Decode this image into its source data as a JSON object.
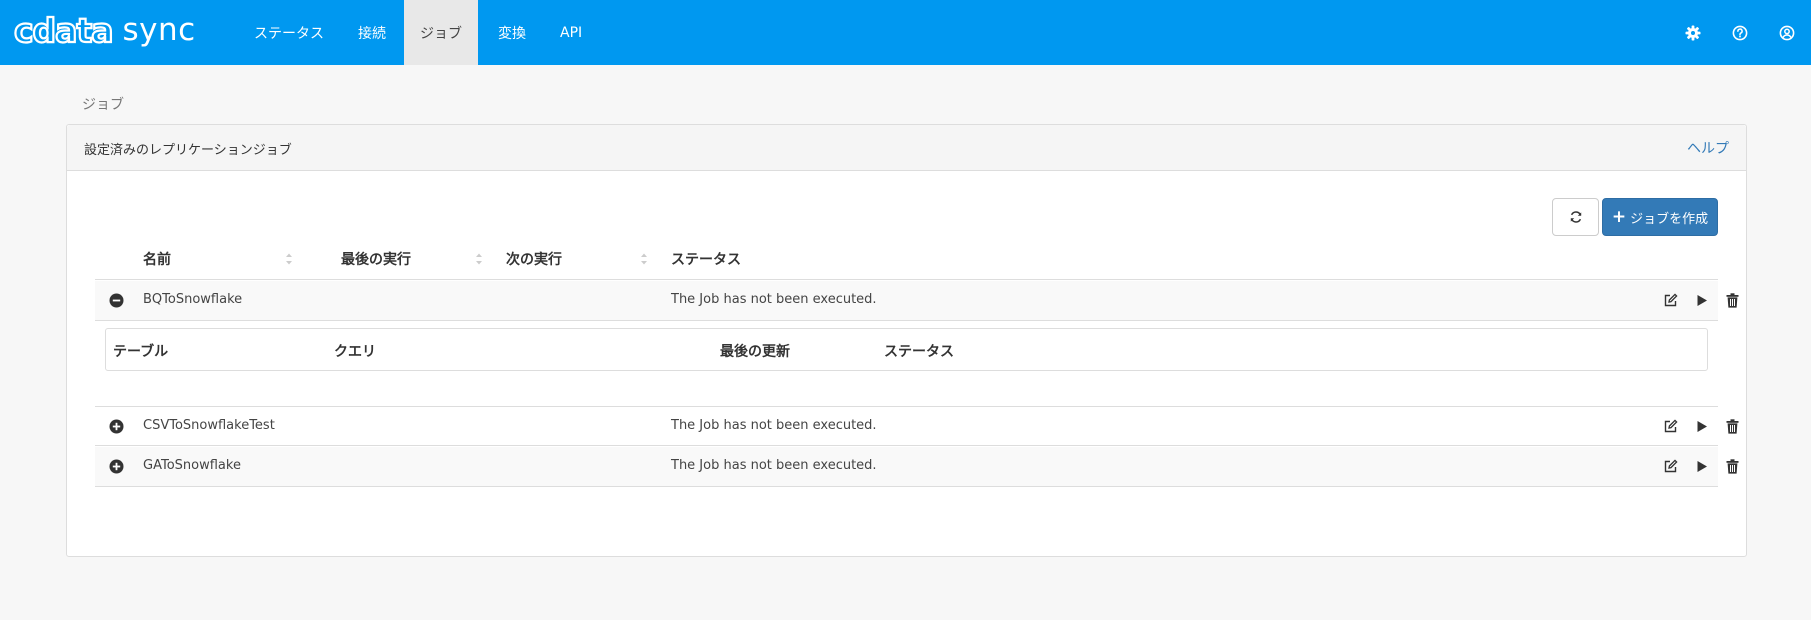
{
  "app": {
    "logo_mark": "cdata",
    "logo_word": "sync"
  },
  "nav": {
    "items": [
      {
        "label": "ステータス"
      },
      {
        "label": "接続"
      },
      {
        "label": "ジョブ",
        "active": true
      },
      {
        "label": "変換"
      },
      {
        "label": "API"
      }
    ]
  },
  "top_icons": [
    "gear-icon",
    "help-icon",
    "user-icon"
  ],
  "breadcrumb": "ジョブ",
  "panel": {
    "title": "設定済みのレプリケーションジョブ",
    "help": "ヘルプ",
    "create_button": "ジョブを作成"
  },
  "table": {
    "columns": [
      "名前",
      "最後の実行",
      "次の実行",
      "ステータス"
    ],
    "rows": [
      {
        "name": "BQToSnowflake",
        "status": "The Job has not been executed.",
        "expanded": true
      },
      {
        "name": "CSVToSnowflakeTest",
        "status": "The Job has not been executed.",
        "expanded": false
      },
      {
        "name": "GAToSnowflake",
        "status": "The Job has not been executed.",
        "expanded": false
      }
    ]
  },
  "subtable": {
    "columns": [
      "テーブル",
      "クエリ",
      "最後の更新",
      "ステータス"
    ]
  },
  "colors": {
    "topbar": "#0098f0",
    "primary_button": "#337ab7",
    "link": "#337ab7"
  }
}
